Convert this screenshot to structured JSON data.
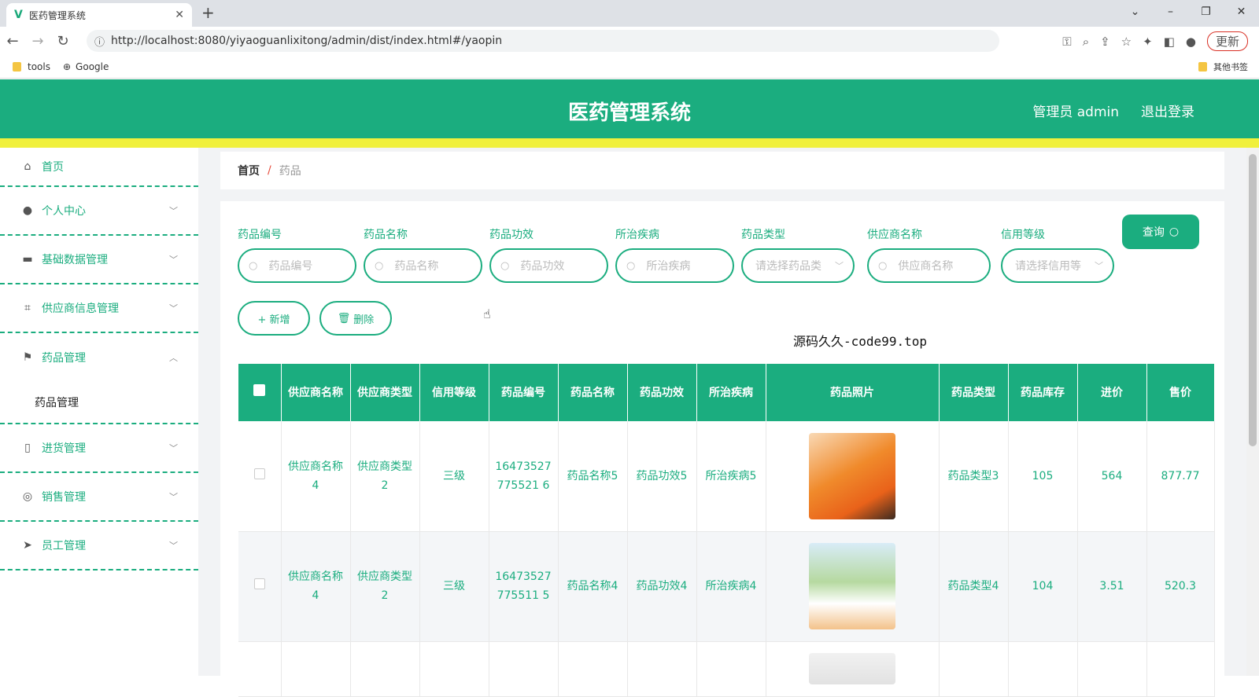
{
  "browser": {
    "tab_title": "医药管理系统",
    "url": "http://localhost:8080/yiyaoguanlixitong/admin/dist/index.html#/yaopin",
    "update_label": "更新",
    "bookmarks": [
      {
        "label": "tools"
      },
      {
        "label": "Google"
      }
    ],
    "other_bookmarks": "其他书签"
  },
  "app": {
    "title": "医药管理系统",
    "user": "管理员 admin",
    "logout": "退出登录"
  },
  "sidebar": {
    "items": [
      {
        "label": "首页",
        "icon": "home-icon"
      },
      {
        "label": "个人中心",
        "icon": "user-icon"
      },
      {
        "label": "基础数据管理",
        "icon": "monitor-icon"
      },
      {
        "label": "供应商信息管理",
        "icon": "crop-icon"
      },
      {
        "label": "药品管理",
        "icon": "flag-icon"
      },
      {
        "label": "进货管理",
        "icon": "phone-icon"
      },
      {
        "label": "销售管理",
        "icon": "target-icon"
      },
      {
        "label": "员工管理",
        "icon": "send-icon"
      }
    ],
    "submenu": "药品管理"
  },
  "breadcrumb": {
    "home": "首页",
    "sep": "/",
    "current": "药品"
  },
  "filters": [
    {
      "label": "药品编号",
      "placeholder": "药品编号",
      "type": "input"
    },
    {
      "label": "药品名称",
      "placeholder": "药品名称",
      "type": "input"
    },
    {
      "label": "药品功效",
      "placeholder": "药品功效",
      "type": "input"
    },
    {
      "label": "所治疾病",
      "placeholder": "所治疾病",
      "type": "input"
    },
    {
      "label": "药品类型",
      "placeholder": "请选择药品类",
      "type": "select"
    },
    {
      "label": "供应商名称",
      "placeholder": "供应商名称",
      "type": "input"
    },
    {
      "label": "信用等级",
      "placeholder": "请选择信用等",
      "type": "select"
    }
  ],
  "query_label": "查询",
  "actions": {
    "add": "+ 新增",
    "delete": "删除"
  },
  "watermark": "源码久久-code99.top",
  "table": {
    "headers": [
      "供应商名称",
      "供应商类型",
      "信用等级",
      "药品编号",
      "药品名称",
      "药品功效",
      "所治疾病",
      "药品照片",
      "药品类型",
      "药品库存",
      "进价",
      "售价"
    ],
    "rows": [
      {
        "supplier": "供应商名称4",
        "supplier_type": "供应商类型2",
        "credit": "三级",
        "code": "16473527775521 6",
        "name": "药品名称5",
        "effect": "药品功效5",
        "disease": "所治疾病5",
        "type": "药品类型3",
        "stock": "105",
        "cost": "564",
        "price": "877.77"
      },
      {
        "supplier": "供应商名称4",
        "supplier_type": "供应商类型2",
        "credit": "三级",
        "code": "16473527775511 5",
        "name": "药品名称4",
        "effect": "药品功效4",
        "disease": "所治疾病4",
        "type": "药品类型4",
        "stock": "104",
        "cost": "3.51",
        "price": "520.3"
      }
    ]
  },
  "colors": {
    "primary": "#1bad7f",
    "accent_bar": "#f0f03c"
  }
}
